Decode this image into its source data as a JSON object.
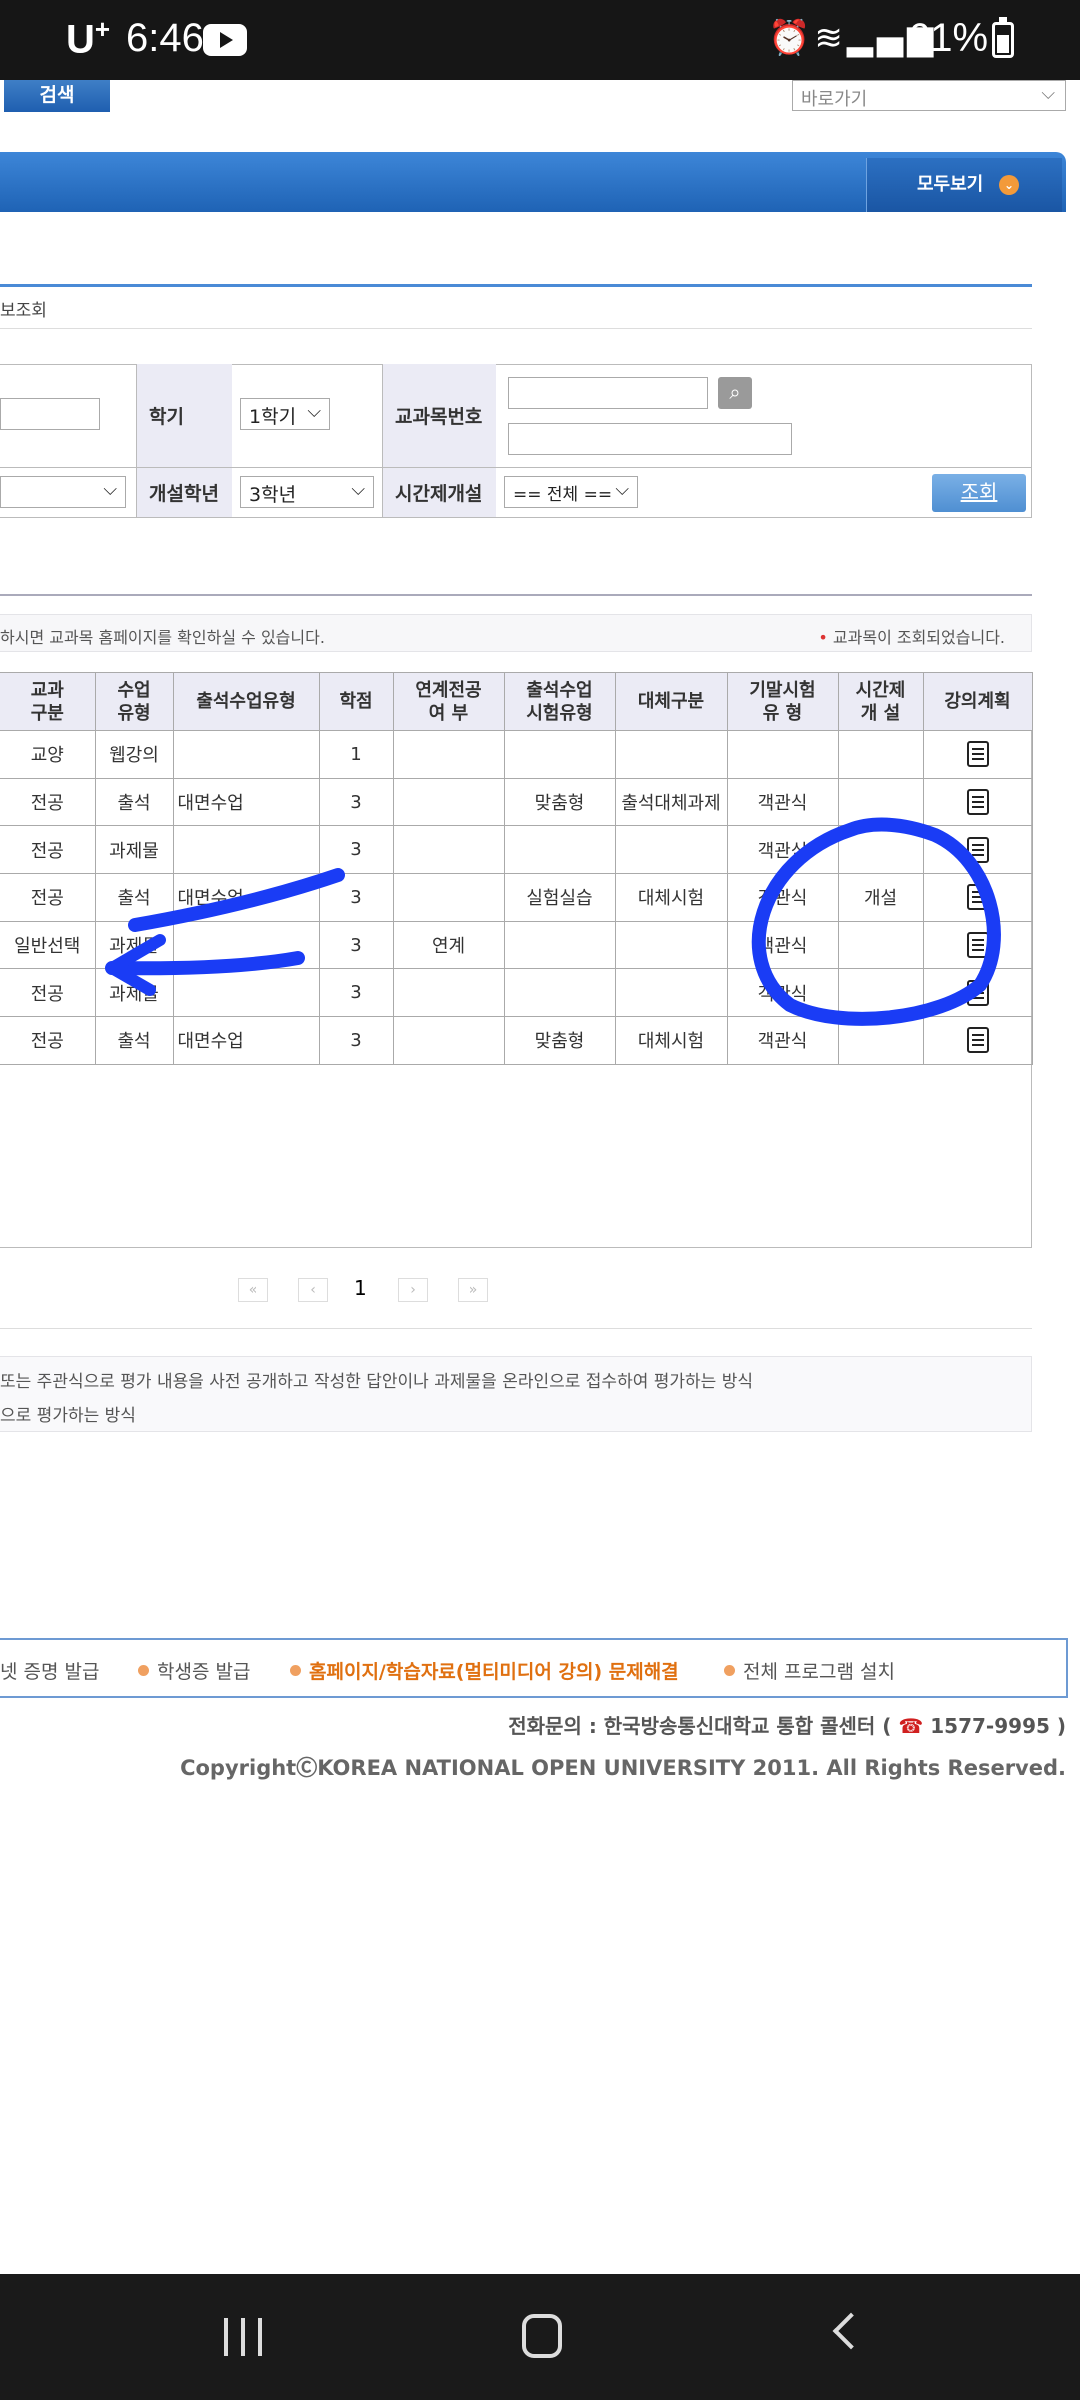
{
  "status_bar": {
    "carrier": "U",
    "carrier_sup": "+",
    "time": "6:46",
    "battery": "61%"
  },
  "header": {
    "search_button": "검색",
    "goto_select": "바로가기",
    "view_all": "모두보기"
  },
  "page_title": "보조회",
  "form": {
    "semester_label": "학기",
    "semester_value": "1학기",
    "course_no_label": "교과목번호",
    "grade_label": "개설학년",
    "grade_value": "3학년",
    "parttime_label": "시간제개설",
    "parttime_value": "== 전체 ==",
    "query_button": "조회"
  },
  "info": {
    "left": "하시면 교과목 홈페이지를 확인하실 수 있습니다.",
    "right_bullet": "•",
    "right": "교과목이 조회되었습니다."
  },
  "table": {
    "headers": {
      "col1": [
        "교과",
        "구분"
      ],
      "col2": [
        "수업",
        "유형"
      ],
      "col3": [
        "출석수업유형"
      ],
      "col4": [
        "학점"
      ],
      "col5": [
        "연계전공",
        "여  부"
      ],
      "col6": [
        "출석수업",
        "시험유형"
      ],
      "col7": [
        "대체구분"
      ],
      "col8": [
        "기말시험",
        "유  형"
      ],
      "col9": [
        "시간제",
        "개  설"
      ],
      "col10": [
        "강의계획"
      ]
    },
    "rows": [
      [
        "교양",
        "웹강의",
        "",
        "1",
        "",
        "",
        "",
        "",
        ""
      ],
      [
        "전공",
        "출석",
        "대면수업",
        "3",
        "",
        "맞춤형",
        "출석대체과제",
        "객관식",
        ""
      ],
      [
        "전공",
        "과제물",
        "",
        "3",
        "",
        "",
        "",
        "객관식",
        ""
      ],
      [
        "전공",
        "출석",
        "대면수업",
        "3",
        "",
        "실험실습",
        "대체시험",
        "객관식",
        "개설"
      ],
      [
        "일반선택",
        "과제물",
        "",
        "3",
        "연계",
        "",
        "",
        "객관식",
        ""
      ],
      [
        "전공",
        "과제물",
        "",
        "3",
        "",
        "",
        "",
        "객관식",
        ""
      ],
      [
        "전공",
        "출석",
        "대면수업",
        "3",
        "",
        "맞춤형",
        "대체시험",
        "객관식",
        ""
      ]
    ]
  },
  "pagination": {
    "first": "«",
    "prev": "‹",
    "current": "1",
    "next": "›",
    "last": "»"
  },
  "notes": {
    "line1": "또는 주관식으로 평가 내용을 사전 공개하고 작성한 답안이나 과제물을 온라인으로 접수하여 평가하는 방식",
    "line2": "으로 평가하는 방식"
  },
  "footer": {
    "link1": "넷 증명 발급",
    "link2": "학생증 발급",
    "link3": "홈페이지/학습자료(멀티미디어 강의) 문제해결",
    "link4": "전체 프로그램 설치",
    "contact_prefix": "전화문의 : 한국방송통신대학교 통합 콜센터 (",
    "contact_icon": "☎",
    "contact_number": "1577-9995 )",
    "copyright": "CopyrightⒸKOREA NATIONAL OPEN UNIVERSITY 2011. All Rights Reserved."
  },
  "colors": {
    "brand_blue": "#1f63b5",
    "annotation_blue": "#1a3cf5",
    "highlight_orange": "#e07010"
  }
}
